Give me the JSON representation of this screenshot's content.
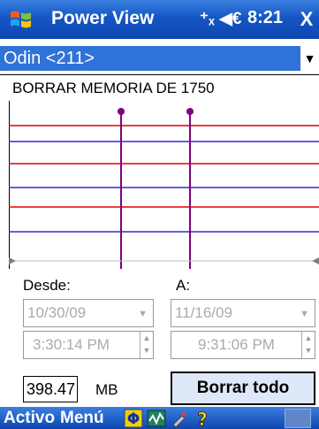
{
  "titlebar": {
    "app_title": "Power View",
    "status_icons": "⁺ₓ ◀€",
    "clock": "8:21",
    "close_label": "X"
  },
  "device_select": {
    "value": "Odin <211>"
  },
  "banner": "BORRAR MEMORIA DE 1750",
  "chart_data": {
    "type": "line",
    "title": "",
    "xlabel": "",
    "ylabel": "",
    "grid": false,
    "series": [
      {
        "color": "#e00000",
        "level": "upper-red"
      },
      {
        "color": "#2c2cd8",
        "level": "upper-blue"
      },
      {
        "color": "#e00000",
        "level": "mid-red"
      },
      {
        "color": "#2c2cd8",
        "level": "mid-blue"
      },
      {
        "color": "#e00000",
        "level": "lower-red"
      },
      {
        "color": "#2c2cd8",
        "level": "lower-blue"
      }
    ],
    "markers": [
      {
        "color": "#800080"
      },
      {
        "color": "#800080"
      }
    ]
  },
  "form": {
    "desde_label": "Desde:",
    "a_label": "A:",
    "desde_date": "10/30/09",
    "a_date": "11/16/09",
    "desde_time": "3:30:14 PM",
    "a_time": "9:31:06 PM",
    "size_value": "398.47",
    "size_unit": "MB",
    "borrar_label": "Borrar todo"
  },
  "bottombar": {
    "activo_label": "Activo",
    "menu_label": "Menú"
  },
  "colors": {
    "titlebar": "#1556c4",
    "selection": "#2f72d8",
    "red_line": "#e00000",
    "blue_line": "#2c2cd8",
    "marker": "#800080"
  }
}
